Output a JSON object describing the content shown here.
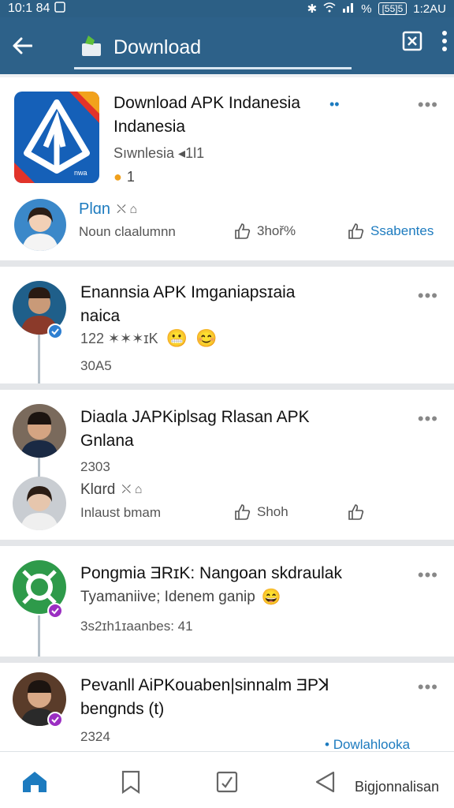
{
  "status": {
    "time": "10:1 84",
    "battery": "[55]5",
    "percent": "%",
    "clock": "1:2AU"
  },
  "appbar": {
    "title": "Download"
  },
  "cards": [
    {
      "title": "Download APK Indanesia",
      "title2": "Indanesia",
      "sub": "Sıwnlesia ◂1l1",
      "count": "1",
      "author": "Plɑn",
      "author_detail": "Noun claalumnn",
      "like_label": "3hoř%",
      "share_label": "Ssabentes"
    },
    {
      "title": "Enannsia APK Imganiapsɪaia",
      "title2": "naica",
      "reactions": "122 ✶✶✶ɪK",
      "time": "30A5"
    },
    {
      "title": "Diaɑla JAPKiplsag Rlasan APK",
      "title2": "Gnlana",
      "time": "2303",
      "author": "Klɑrd",
      "author_detail": "Inlaust bmam",
      "like_label": "Shoh"
    },
    {
      "title": "Pongmia ƎRɪK: Nangoan skdraulak",
      "subtitle": "Tyamaniive; Idenem ganip",
      "meta": "3s2ɪh1ɪaanbes: 41"
    },
    {
      "title": "Pevanll AiPKouaben|sinnalm ƎPꓘ",
      "title2": "bengnds (t)",
      "time": "2324",
      "link": "Dowlahlooka"
    }
  ],
  "bottom": {
    "label": "Bigjonnalisan"
  },
  "colors": {
    "bar": "#2d6189",
    "accent": "#1d7bbf",
    "badge_blue": "#2e7fd1",
    "badge_purple": "#9b2ec2"
  }
}
